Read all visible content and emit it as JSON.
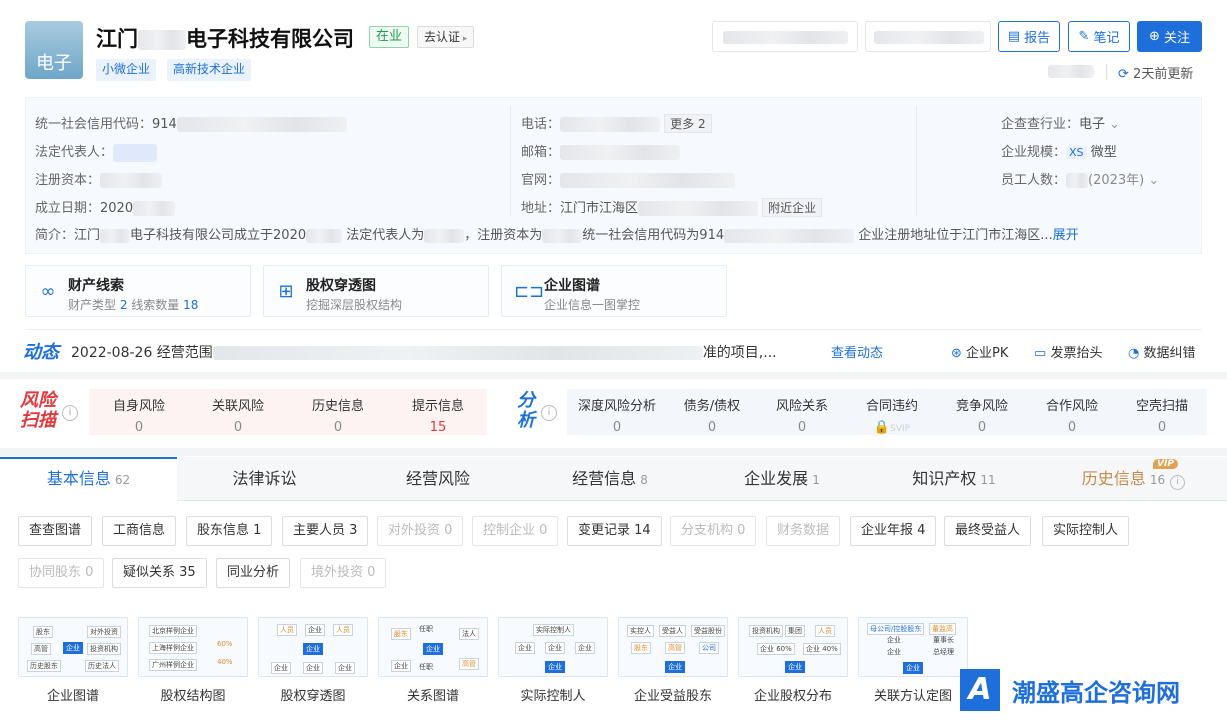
{
  "company": {
    "logo_text": "电子",
    "name_left": "江门",
    "name_right": "电子科技有限公司",
    "status": "在业",
    "certify": "去认证",
    "tags": [
      "小微企业",
      "高新技术企业"
    ],
    "updated": "2天前更新"
  },
  "actions": {
    "report": "报告",
    "notes": "笔记",
    "follow": "关注"
  },
  "info": {
    "credit_code_label": "统一社会信用代码：",
    "credit_code_prefix": "914",
    "legal_rep_label": "法定代表人：",
    "reg_capital_label": "注册资本：",
    "founded_label": "成立日期：",
    "founded_prefix": "2020",
    "phone_label": "电话：",
    "phone_more": "更多 2",
    "email_label": "邮箱：",
    "website_label": "官网：",
    "address_label": "地址：",
    "address_prefix": "江门市江海区",
    "nearby": "附近企业",
    "industry_label": "企查查行业：",
    "industry_value": "电子",
    "scale_label": "企业规模：",
    "scale_badge": "XS",
    "scale_value": "微型",
    "staff_label": "员工人数：",
    "staff_year": "(2023年)",
    "intro_label": "简介：",
    "intro_a": "江门",
    "intro_b": "电子科技有限公司成立于2020",
    "intro_c": "法定代表人为",
    "intro_d": "，注册资本为",
    "intro_e": "统一社会信用代码为914",
    "intro_f": "企业注册地址位于江门市江海区...",
    "expand": "展开"
  },
  "quick_links": [
    {
      "title": "财产线索",
      "sub_a": "财产类型 ",
      "sub_a_num": "2",
      "sub_b": "  线索数量 ",
      "sub_b_num": "18"
    },
    {
      "title": "股权穿透图",
      "sub": "挖掘深层股权结构"
    },
    {
      "title": "企业图谱",
      "sub": "企业信息一图掌控"
    }
  ],
  "dynamic": {
    "label": "动态",
    "date_text": "2022-08-26 经营范围",
    "tail_text": "准的项目,...",
    "more": "查看动态",
    "tools": [
      "企业PK",
      "发票抬头",
      "数据纠错"
    ]
  },
  "risk": {
    "title": "风险扫描",
    "items": [
      {
        "label": "自身风险",
        "value": "0"
      },
      {
        "label": "关联风险",
        "value": "0"
      },
      {
        "label": "历史信息",
        "value": "0"
      },
      {
        "label": "提示信息",
        "value": "15"
      }
    ]
  },
  "analysis": {
    "title": "分析",
    "items": [
      {
        "label": "深度风险分析",
        "value": "0"
      },
      {
        "label": "债务/债权",
        "value": "0"
      },
      {
        "label": "风险关系",
        "value": "0"
      },
      {
        "label": "合同违约",
        "value": "SVIP"
      },
      {
        "label": "竞争风险",
        "value": "0"
      },
      {
        "label": "合作风险",
        "value": "0"
      },
      {
        "label": "空壳扫描",
        "value": "0"
      }
    ]
  },
  "tabs": [
    {
      "label": "基本信息",
      "count": "62"
    },
    {
      "label": "法律诉讼",
      "count": ""
    },
    {
      "label": "经营风险",
      "count": ""
    },
    {
      "label": "经营信息",
      "count": "8"
    },
    {
      "label": "企业发展",
      "count": "1"
    },
    {
      "label": "知识产权",
      "count": "11"
    },
    {
      "label": "历史信息",
      "count": "16"
    }
  ],
  "vip_badge": "VIP",
  "chips": [
    "查查图谱",
    "工商信息",
    "股东信息 1",
    "主要人员 3",
    "对外投资 0",
    "控制企业 0",
    "变更记录 14",
    "分支机构 0",
    "财务数据",
    "企业年报 4",
    "最终受益人",
    "实际控制人",
    "协同股东 0",
    "疑似关系 35",
    "同业分析",
    "境外投资 0"
  ],
  "thumbs": [
    "企业图谱",
    "股权结构图",
    "股权穿透图",
    "关系图谱",
    "实际控制人",
    "企业受益股东",
    "企业股权分布",
    "关联方认定图"
  ],
  "thumb_mini": {
    "t1": [
      "股东",
      "对外投资",
      "高管",
      "企业",
      "投资机构",
      "历史股东",
      "历史法人"
    ],
    "t2": [
      "北京样例企业",
      "上海样例企业",
      "广州样例企业",
      "60%",
      "40%"
    ],
    "t3": [
      "人员",
      "企业",
      "人员",
      "企业",
      "企业",
      "企业",
      "企业"
    ],
    "t4": [
      "股东",
      "任职",
      "法人",
      "企业",
      "高管",
      "任职",
      "企业"
    ],
    "t5": [
      "实际控制人",
      "企业",
      "企业",
      "企业",
      "企业"
    ],
    "t6": [
      "实控人",
      "受益人",
      "受益股份",
      "股东",
      "高管",
      "公司",
      "企业"
    ],
    "t7": [
      "投资机构",
      "集团",
      "人员",
      "企业 60%",
      "企业 40%",
      "企业"
    ],
    "t8": [
      "母公司/控股股东",
      "董监高",
      "企业",
      "董事长",
      "企业",
      "总经理",
      "企业"
    ]
  },
  "watermark": "潮盛高企咨询网"
}
